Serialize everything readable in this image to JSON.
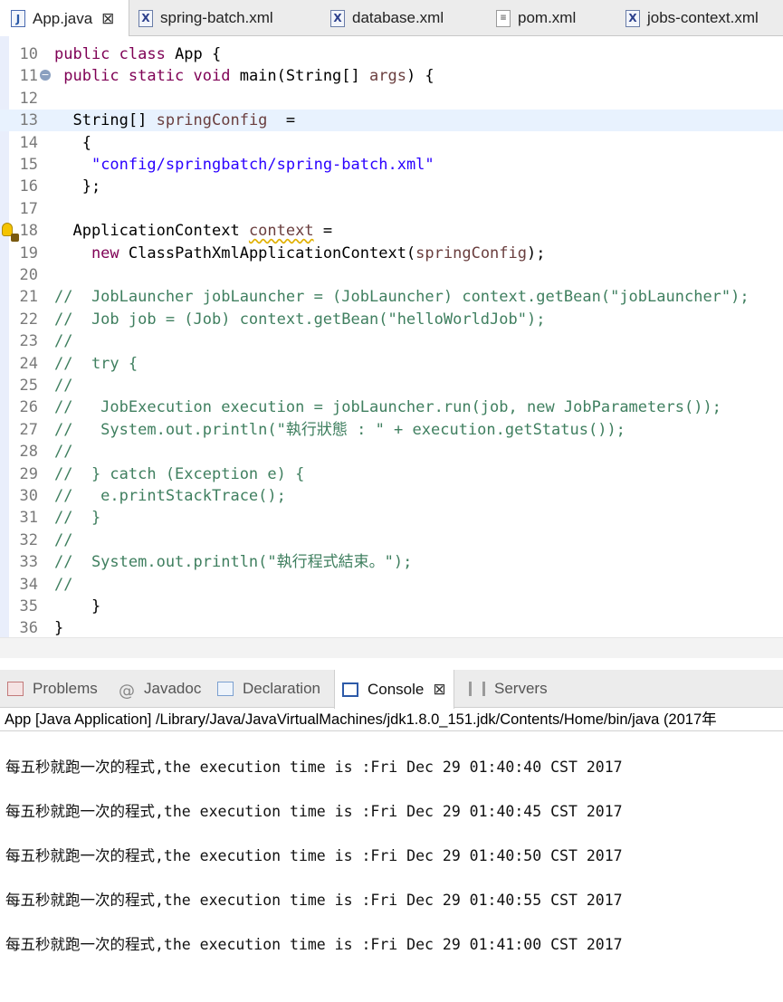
{
  "editor_tabs": [
    {
      "label": "App.java",
      "icon": "java-file-icon",
      "active": true
    },
    {
      "label": "spring-batch.xml",
      "icon": "xml-file-icon"
    },
    {
      "label": "database.xml",
      "icon": "xml-file-icon"
    },
    {
      "label": "pom.xml",
      "icon": "pom-file-icon"
    },
    {
      "label": "jobs-context.xml",
      "icon": "xml-file-icon"
    }
  ],
  "close_glyph": "⊠",
  "code_lines": [
    {
      "n": "10",
      "parts": [
        [
          "kw",
          "public class "
        ],
        [
          "",
          "App {"
        ]
      ]
    },
    {
      "n": "11",
      "fold": true,
      "parts": [
        [
          "kw",
          " public static void "
        ],
        [
          "",
          "main(String[] "
        ],
        [
          "var",
          "args"
        ],
        [
          "",
          ") {"
        ]
      ]
    },
    {
      "n": "12",
      "parts": []
    },
    {
      "n": "13",
      "hl": true,
      "parts": [
        [
          "",
          "  String[] "
        ],
        [
          "var",
          "springConfig"
        ],
        [
          "",
          "  ="
        ]
      ]
    },
    {
      "n": "14",
      "parts": [
        [
          "",
          "   {"
        ]
      ]
    },
    {
      "n": "15",
      "parts": [
        [
          "",
          "    "
        ],
        [
          "str",
          "\"config/springbatch/spring-batch.xml\""
        ]
      ]
    },
    {
      "n": "16",
      "parts": [
        [
          "",
          "   };"
        ]
      ]
    },
    {
      "n": "17",
      "parts": []
    },
    {
      "n": "18",
      "warn_marker": true,
      "parts": [
        [
          "",
          "  ApplicationContext "
        ],
        [
          "var warn",
          "context"
        ],
        [
          "",
          " ="
        ]
      ]
    },
    {
      "n": "19",
      "parts": [
        [
          "kw",
          "    new "
        ],
        [
          "",
          "ClassPathXmlApplicationContext("
        ],
        [
          "var",
          "springConfig"
        ],
        [
          "",
          ");"
        ]
      ]
    },
    {
      "n": "20",
      "parts": []
    },
    {
      "n": "21",
      "parts": [
        [
          "cm",
          "//  JobLauncher jobLauncher = (JobLauncher) context.getBean(\"jobLauncher\");"
        ]
      ]
    },
    {
      "n": "22",
      "parts": [
        [
          "cm",
          "//  Job job = (Job) context.getBean(\"helloWorldJob\");"
        ]
      ]
    },
    {
      "n": "23",
      "parts": [
        [
          "cm",
          "//"
        ]
      ]
    },
    {
      "n": "24",
      "parts": [
        [
          "cm",
          "//  try {"
        ]
      ]
    },
    {
      "n": "25",
      "parts": [
        [
          "cm",
          "//"
        ]
      ]
    },
    {
      "n": "26",
      "parts": [
        [
          "cm",
          "//   JobExecution execution = jobLauncher.run(job, new JobParameters());"
        ]
      ]
    },
    {
      "n": "27",
      "parts": [
        [
          "cm",
          "//   System.out.println(\"執行狀態 : \" + execution.getStatus());"
        ]
      ]
    },
    {
      "n": "28",
      "parts": [
        [
          "cm",
          "//"
        ]
      ]
    },
    {
      "n": "29",
      "parts": [
        [
          "cm",
          "//  } catch (Exception e) {"
        ]
      ]
    },
    {
      "n": "30",
      "parts": [
        [
          "cm",
          "//   e.printStackTrace();"
        ]
      ]
    },
    {
      "n": "31",
      "parts": [
        [
          "cm",
          "//  }"
        ]
      ]
    },
    {
      "n": "32",
      "parts": [
        [
          "cm",
          "//"
        ]
      ]
    },
    {
      "n": "33",
      "parts": [
        [
          "cm",
          "//  System.out.println(\"執行程式結束。\");"
        ]
      ]
    },
    {
      "n": "34",
      "parts": [
        [
          "cm",
          "//"
        ]
      ]
    },
    {
      "n": "35",
      "parts": [
        [
          "",
          "    }"
        ]
      ]
    },
    {
      "n": "36",
      "parts": [
        [
          "",
          "}"
        ]
      ]
    }
  ],
  "view_tabs": [
    {
      "label": "Problems",
      "icon": "problems-icon"
    },
    {
      "label": "Javadoc",
      "icon": "javadoc-icon",
      "glyph": "@"
    },
    {
      "label": "Declaration",
      "icon": "declaration-icon"
    },
    {
      "label": "Console",
      "icon": "console-icon",
      "active": true
    },
    {
      "label": "Servers",
      "icon": "servers-icon"
    }
  ],
  "console": {
    "title": "App [Java Application] /Library/Java/JavaVirtualMachines/jdk1.8.0_151.jdk/Contents/Home/bin/java (2017年",
    "lines": [
      "每五秒就跑一次的程式,the execution time is :Fri Dec 29 01:40:40 CST 2017",
      "每五秒就跑一次的程式,the execution time is :Fri Dec 29 01:40:45 CST 2017",
      "每五秒就跑一次的程式,the execution time is :Fri Dec 29 01:40:50 CST 2017",
      "每五秒就跑一次的程式,the execution time is :Fri Dec 29 01:40:55 CST 2017",
      "每五秒就跑一次的程式,the execution time is :Fri Dec 29 01:41:00 CST 2017"
    ]
  }
}
